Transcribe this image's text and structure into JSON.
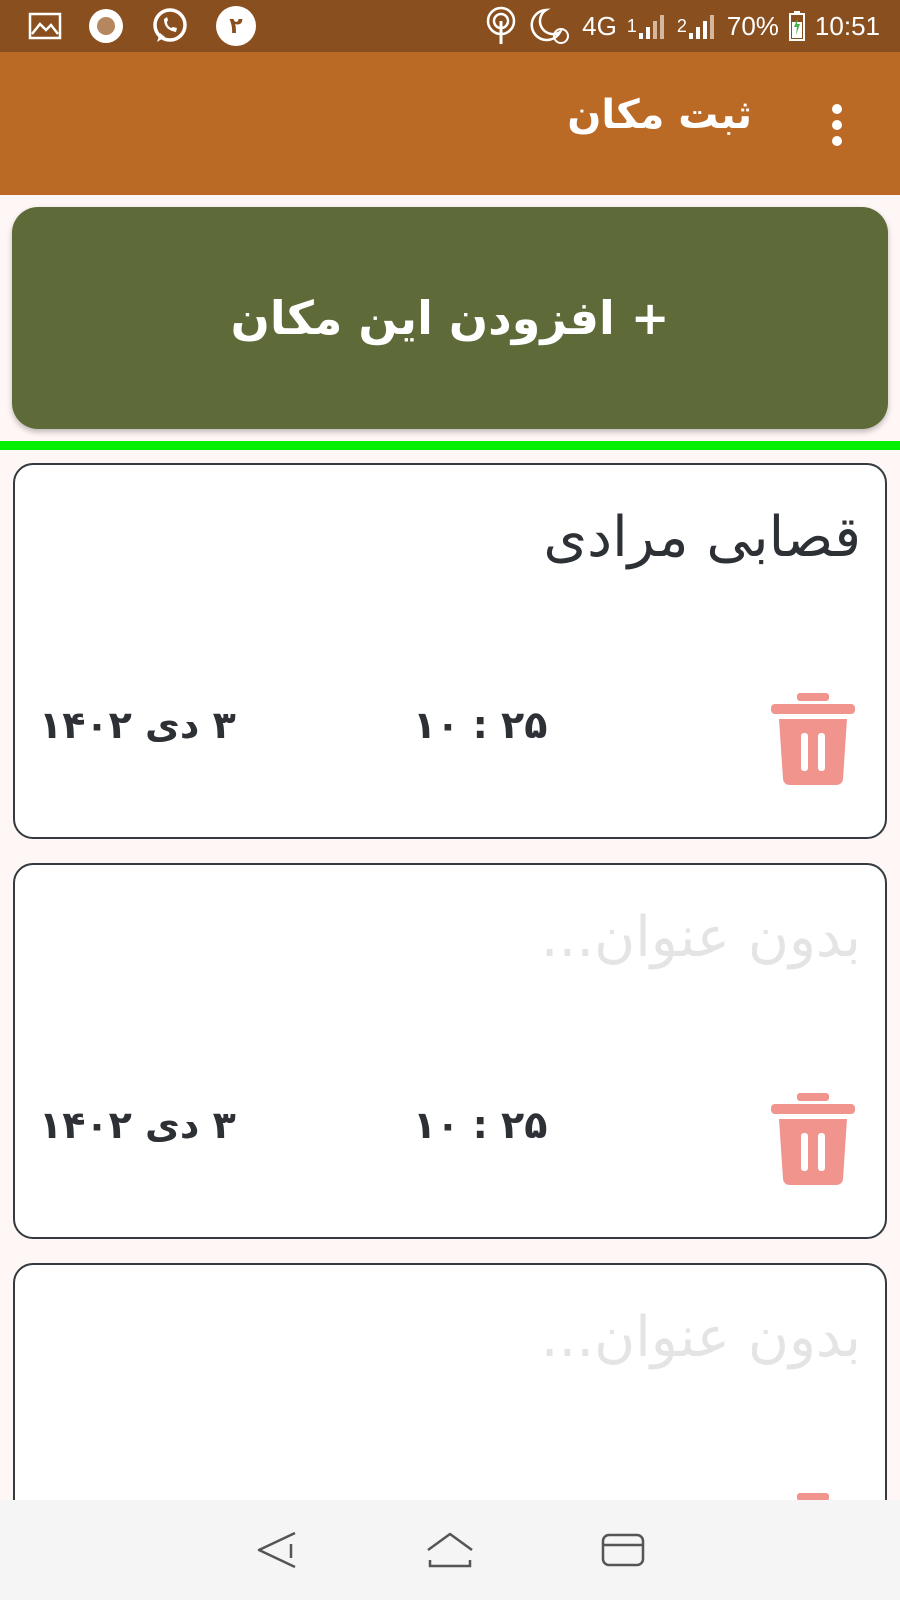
{
  "status_bar": {
    "notification_count": "۲",
    "network": "4G",
    "sim1": "1",
    "sim2": "2",
    "battery": "70%",
    "time": "10:51"
  },
  "app_bar": {
    "title": "ثبت مکان",
    "menu_icon": "more-vert-icon"
  },
  "add_button": {
    "label": "+ افزودن این مکان"
  },
  "colors": {
    "status_bar": "#8a4f1f",
    "app_bar": "#bb6a26",
    "add_button": "#5e6b38",
    "divider": "#00f000",
    "trash": "#f0948d",
    "background": "#fff6f6"
  },
  "places": [
    {
      "title": "قصابی مرادی",
      "time": "۱۰ : ۲۵",
      "date": "۳  دی  ۱۴۰۲"
    },
    {
      "title": "بدون عنوان...",
      "time": "۱۰ : ۲۵",
      "date": "۳  دی  ۱۴۰۲"
    },
    {
      "title": "بدون عنوان..."
    }
  ]
}
